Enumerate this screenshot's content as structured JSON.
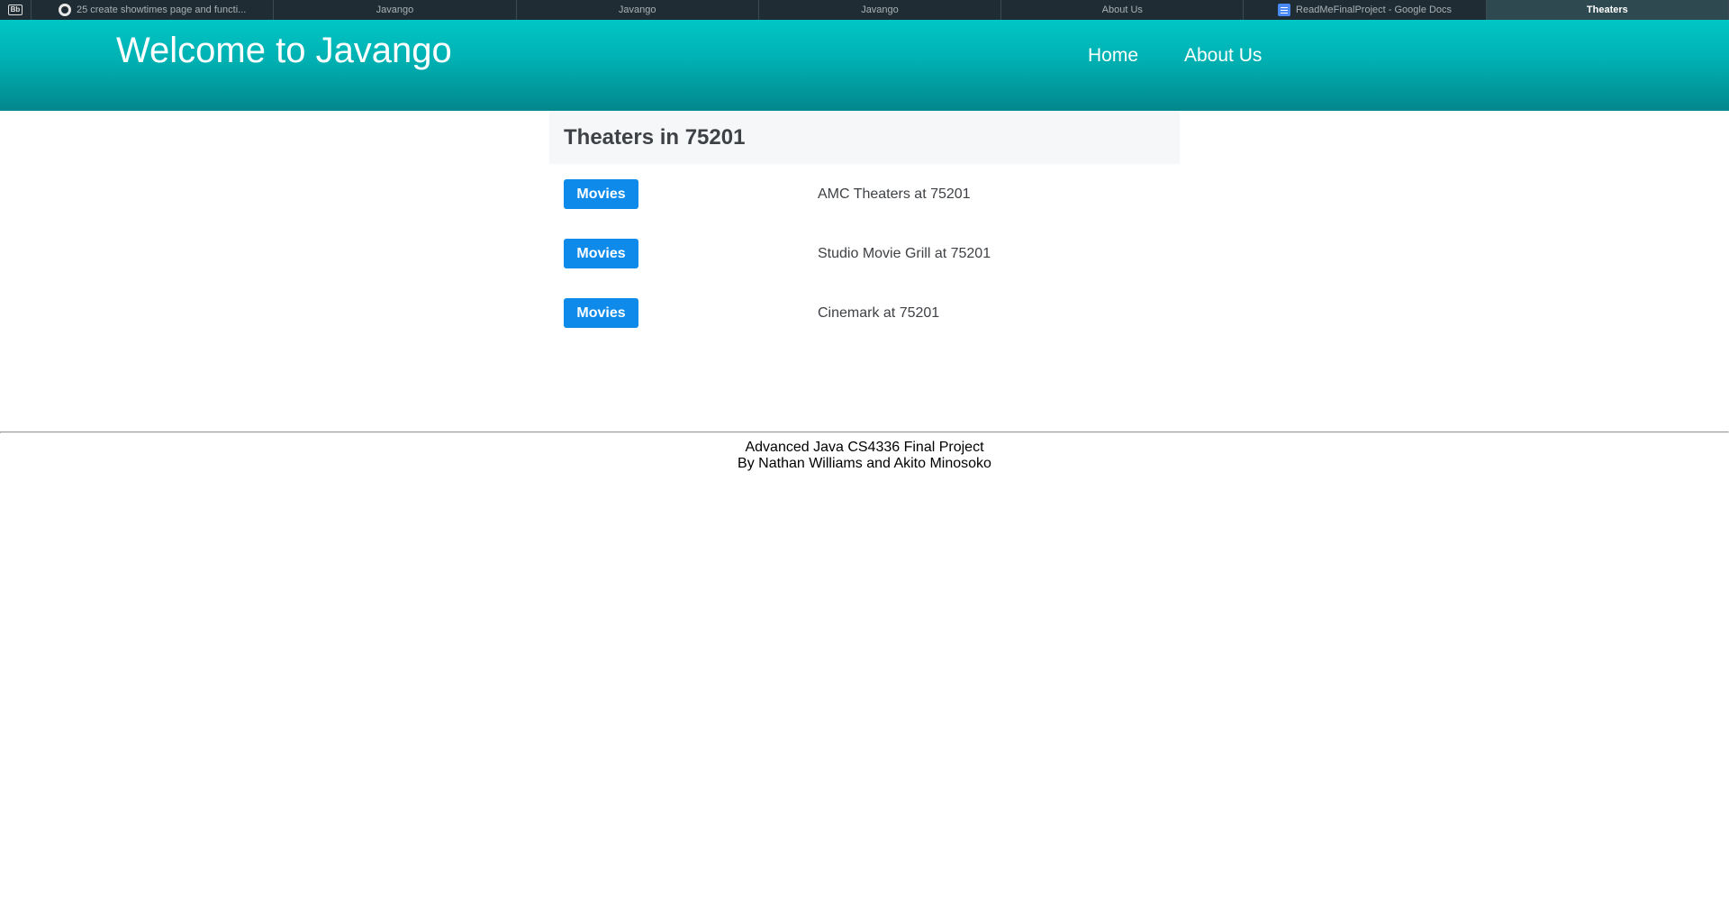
{
  "browser": {
    "tabs": [
      {
        "label": "25 create showtimes page and functi...",
        "icon": "github-icon",
        "active": false
      },
      {
        "label": "Javango",
        "active": false
      },
      {
        "label": "Javango",
        "active": false
      },
      {
        "label": "Javango",
        "active": false
      },
      {
        "label": "About Us",
        "active": false
      },
      {
        "label": "ReadMeFinalProject - Google Docs",
        "icon": "google-docs-icon",
        "active": false
      },
      {
        "label": "Theaters",
        "active": true
      }
    ],
    "first_tab_icon_text": "Bb"
  },
  "header": {
    "title": "Welcome to Javango",
    "nav": {
      "home": "Home",
      "about": "About Us"
    }
  },
  "main": {
    "heading": "Theaters in 75201",
    "theaters": [
      {
        "button": "Movies",
        "name": "AMC Theaters at 75201"
      },
      {
        "button": "Movies",
        "name": "Studio Movie Grill at 75201"
      },
      {
        "button": "Movies",
        "name": "Cinemark at 75201"
      }
    ]
  },
  "footer": {
    "line1": "Advanced Java CS4336 Final Project",
    "line2": "By Nathan Williams and Akito Minosoko"
  },
  "colors": {
    "header_gradient_top": "#00c6c6",
    "header_gradient_bottom": "#02878d",
    "button": "#0d8aea",
    "tabbar": "#1f2c33"
  }
}
